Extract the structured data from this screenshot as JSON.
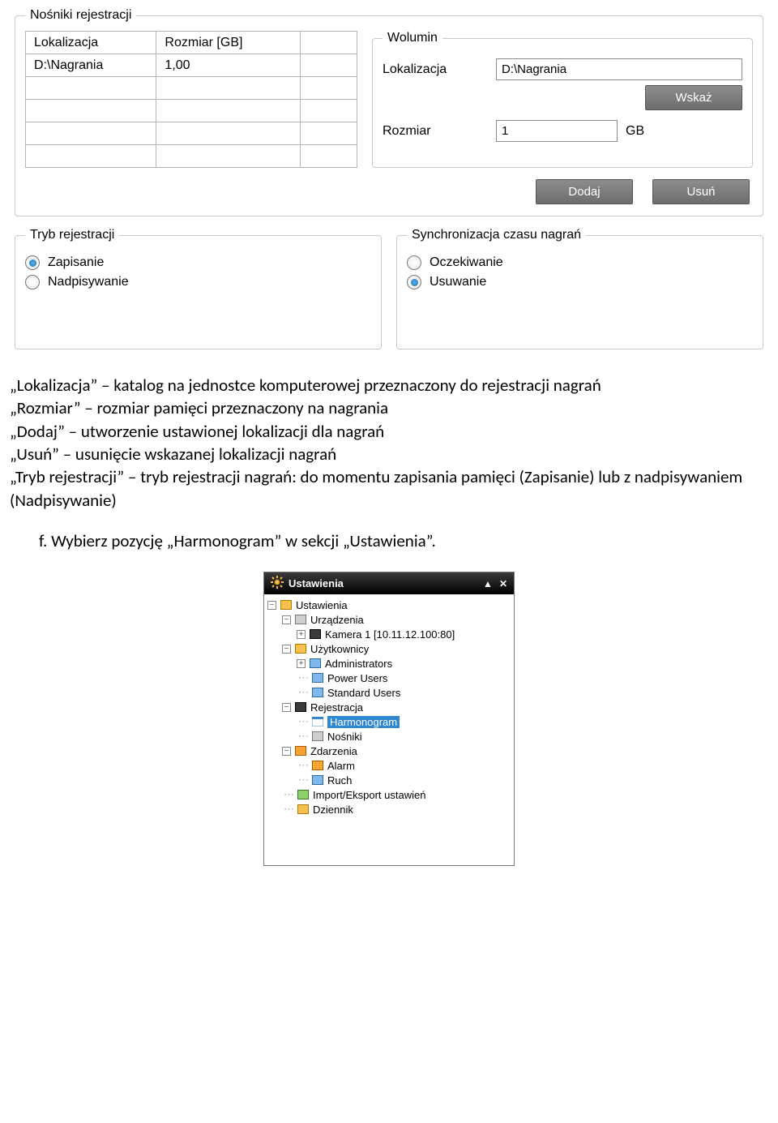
{
  "nosniki": {
    "legend": "Nośniki rejestracji",
    "columns": [
      "Lokalizacja",
      "Rozmiar [GB]",
      ""
    ],
    "row_loc": "D:\\Nagrania",
    "row_size": "1,00",
    "wolumin": {
      "legend": "Wolumin",
      "loc_label": "Lokalizacja",
      "loc_value": "D:\\Nagrania",
      "wskaz_label": "Wskaż",
      "size_label": "Rozmiar",
      "size_value": "1",
      "size_unit": "GB"
    },
    "dodaj_label": "Dodaj",
    "usun_label": "Usuń"
  },
  "tryb": {
    "legend": "Tryb rejestracji",
    "opt1": "Zapisanie",
    "opt2": "Nadpisywanie"
  },
  "sync": {
    "legend": "Synchronizacja czasu nagrań",
    "opt1": "Oczekiwanie",
    "opt2": "Usuwanie"
  },
  "description": {
    "l1": "„Lokalizacja” – katalog na jednostce komputerowej przeznaczony do rejestracji nagrań",
    "l2": "„Rozmiar” – rozmiar pamięci przeznaczony na nagrania",
    "l3": "„Dodaj” – utworzenie ustawionej lokalizacji dla nagrań",
    "l4": "„Usuń” – usunięcie wskazanej lokalizacji nagrań",
    "l5": "„Tryb rejestracji” – tryb rejestracji nagrań: do momentu zapisania pamięci (Zapisanie) lub z nadpisywaniem (Nadpisywanie)",
    "step": "f.   Wybierz pozycję „Harmonogram” w sekcji „Ustawienia”."
  },
  "tree": {
    "title": "Ustawienia",
    "n_ustawienia": "Ustawienia",
    "n_urzadzenia": "Urządzenia",
    "n_kamera": "Kamera 1 [10.11.12.100:80]",
    "n_uzytkownicy": "Użytkownicy",
    "n_admins": "Administrators",
    "n_power": "Power Users",
    "n_standard": "Standard Users",
    "n_rejestracja": "Rejestracja",
    "n_harmonogram": "Harmonogram",
    "n_nosniki": "Nośniki",
    "n_zdarzenia": "Zdarzenia",
    "n_alarm": "Alarm",
    "n_ruch": "Ruch",
    "n_import": "Import/Eksport ustawień",
    "n_dziennik": "Dziennik"
  }
}
